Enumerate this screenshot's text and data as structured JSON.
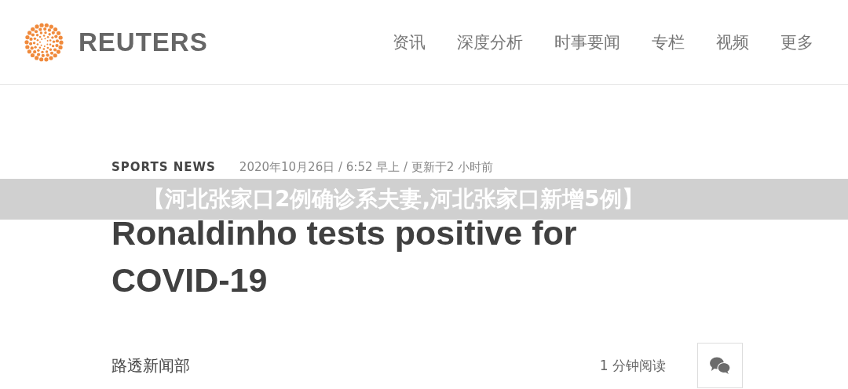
{
  "header": {
    "logo": "REUTERS",
    "nav": [
      {
        "label": "资讯"
      },
      {
        "label": "深度分析"
      },
      {
        "label": "时事要闻"
      },
      {
        "label": "专栏"
      },
      {
        "label": "视频"
      },
      {
        "label": "更多"
      }
    ]
  },
  "article": {
    "kicker": "SPORTS NEWS",
    "date": "2020年10月26日 / 6:52 早上 / 更新于2 小时前",
    "headline": "Ronaldinho tests positive for COVID-19",
    "byline": "路透新闻部",
    "read_time": "1 分钟阅读"
  },
  "overlay_banner": "【河北张家口2例确诊系夫妻,河北张家口新增5例】"
}
